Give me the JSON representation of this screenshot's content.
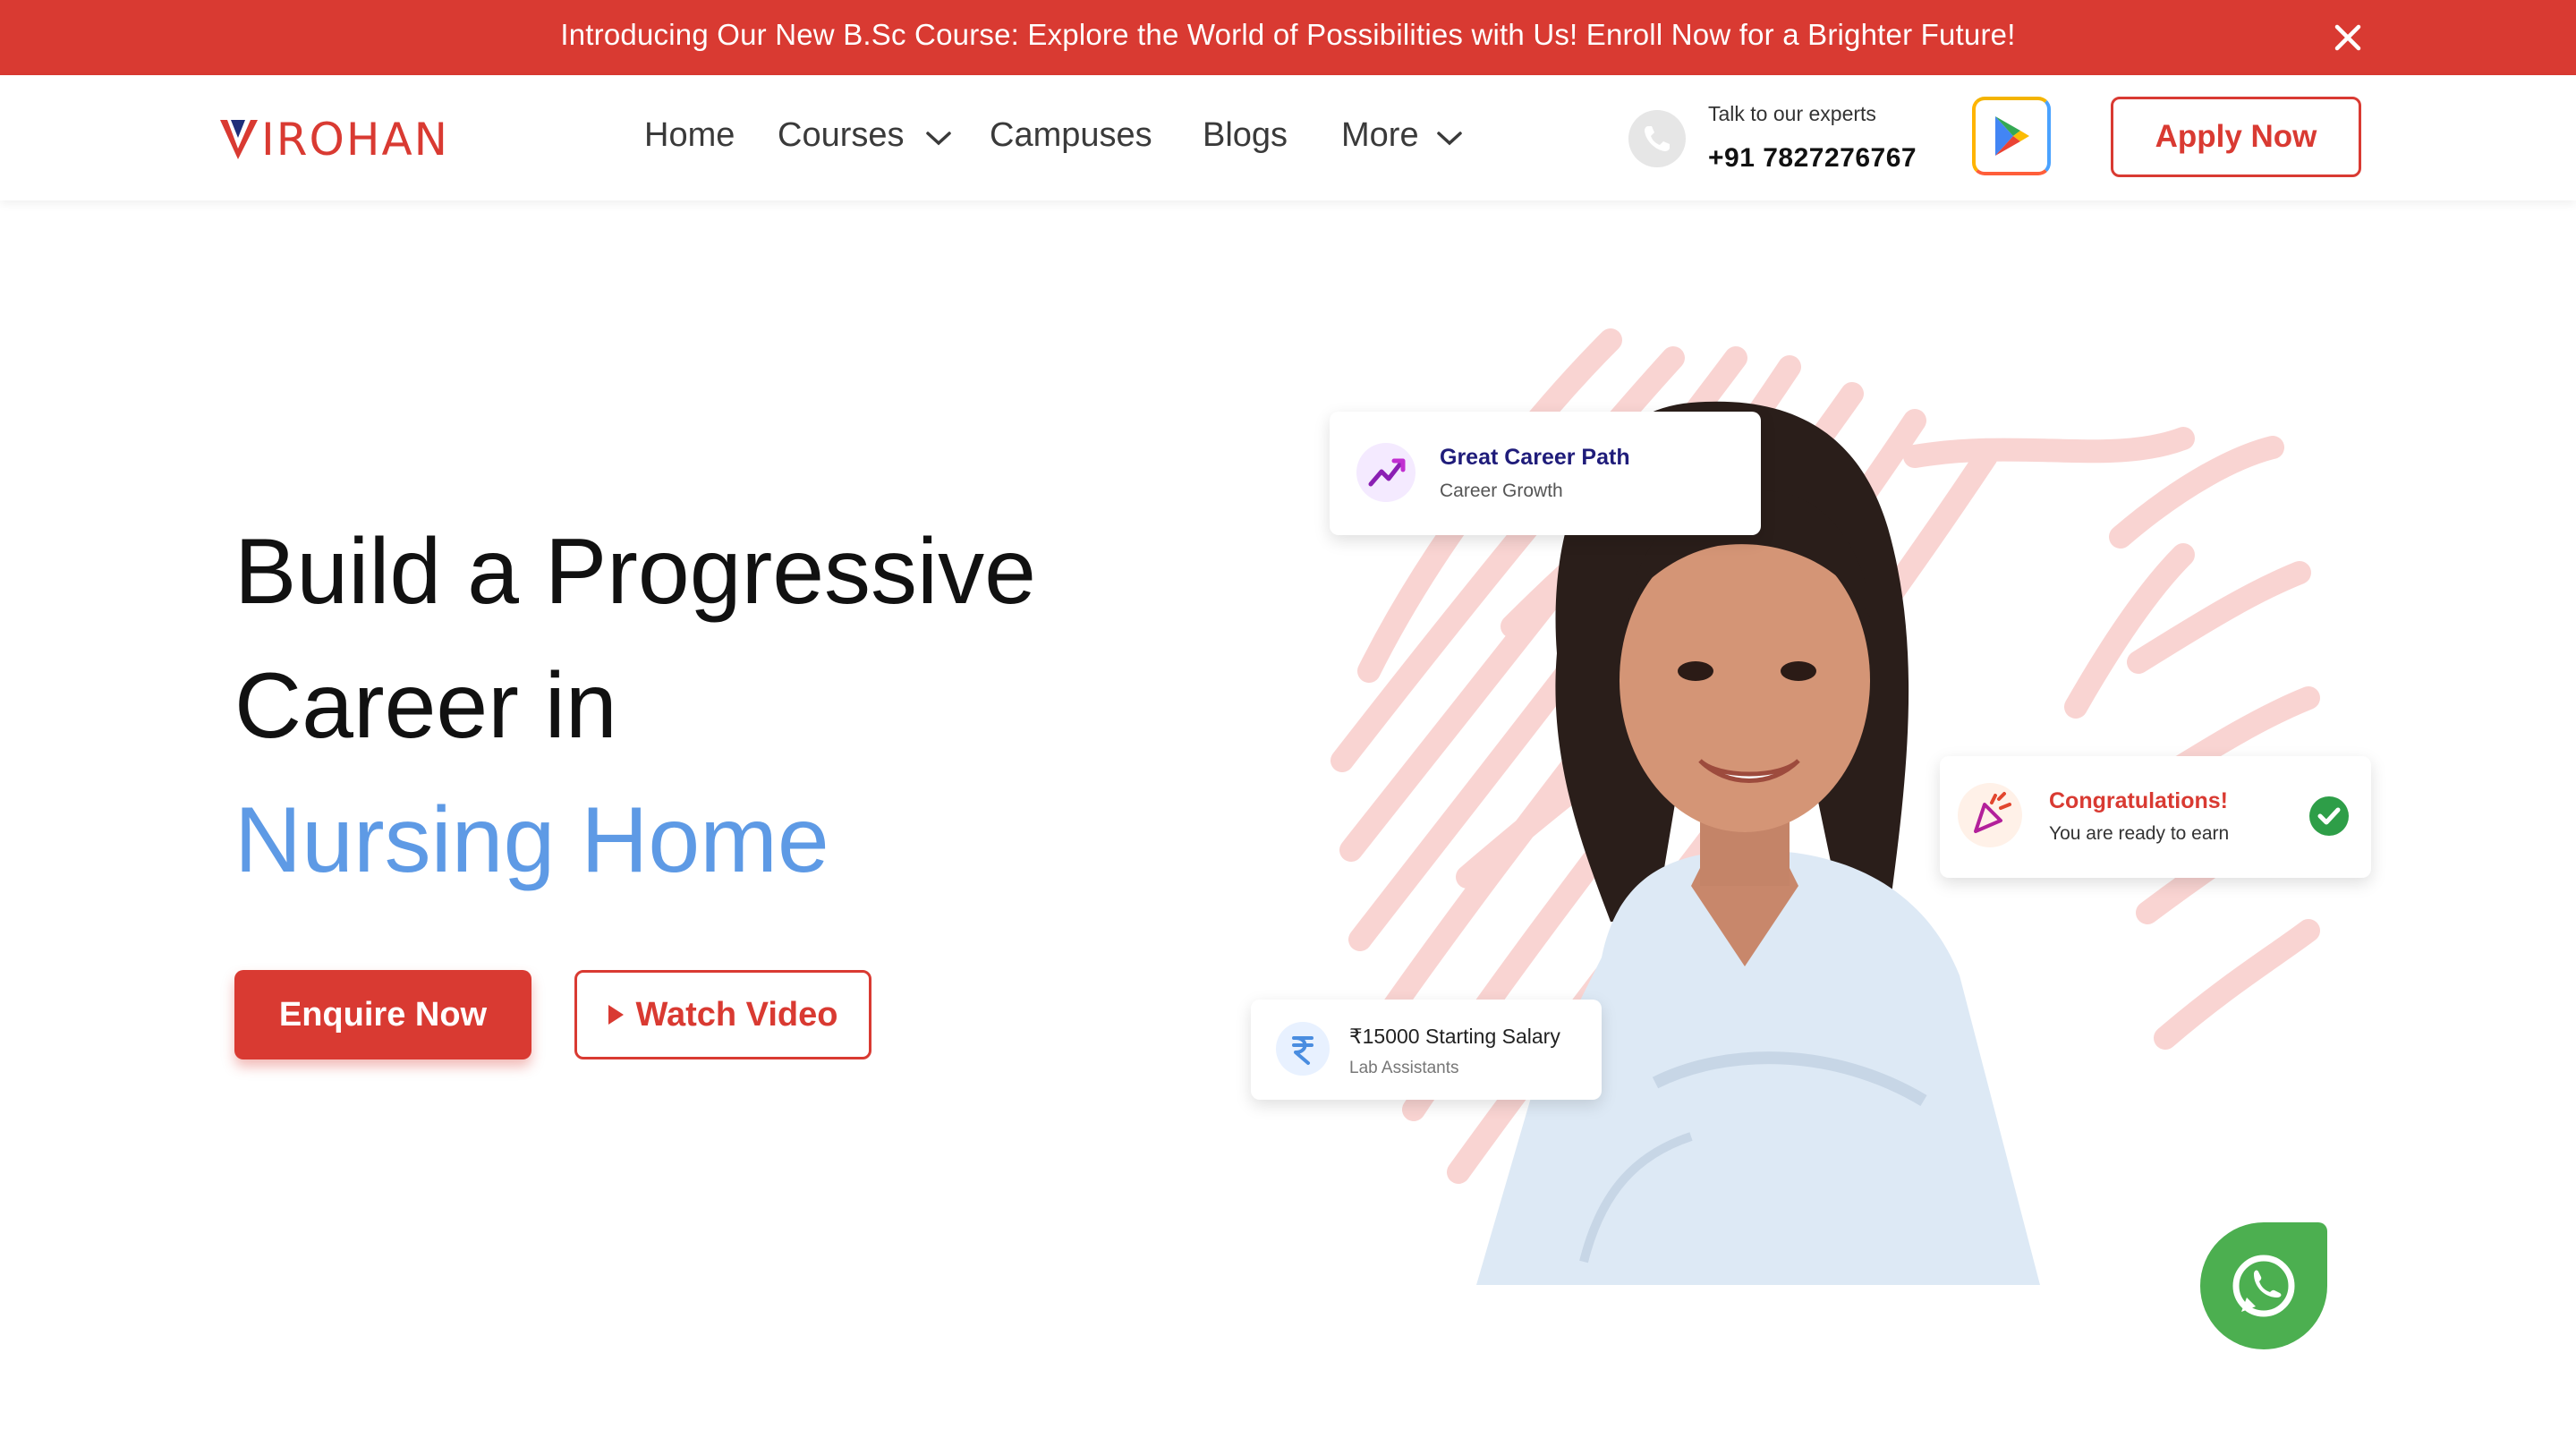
{
  "announcement": {
    "text": "Introducing Our New B.Sc Course: Explore the World of Possibilities with Us! Enroll Now for a Brighter Future!",
    "background": "#d93a32"
  },
  "header": {
    "logo_text": "IROHAN",
    "nav": [
      {
        "label": "Home"
      },
      {
        "label": "Courses"
      },
      {
        "label": "Campuses"
      },
      {
        "label": "Blogs"
      },
      {
        "label": "More"
      }
    ],
    "contact_caption": "Talk to our experts",
    "contact_phone": "+91 7827276767",
    "apply_label": "Apply Now"
  },
  "hero": {
    "line1": "Build a Progressive",
    "line2": "Career in",
    "line3": "Nursing Home",
    "enquire_label": "Enquire Now",
    "watch_label": "Watch Video",
    "accent": "#5e9ae5",
    "brand": "#d93a32"
  },
  "cards": {
    "career": {
      "title": "Great Career Path",
      "subtitle": "Career Growth"
    },
    "congrats": {
      "title": "Congratulations!",
      "subtitle": "You are ready to earn"
    },
    "salary": {
      "title": "₹15000 Starting Salary",
      "subtitle": "Lab Assistants"
    }
  },
  "icons": [
    "close-icon",
    "chevron-down-icon",
    "phone-icon",
    "google-play-icon",
    "trend-up-icon",
    "party-popper-icon",
    "check-circle-icon",
    "rupee-icon",
    "whatsapp-icon",
    "play-icon"
  ]
}
